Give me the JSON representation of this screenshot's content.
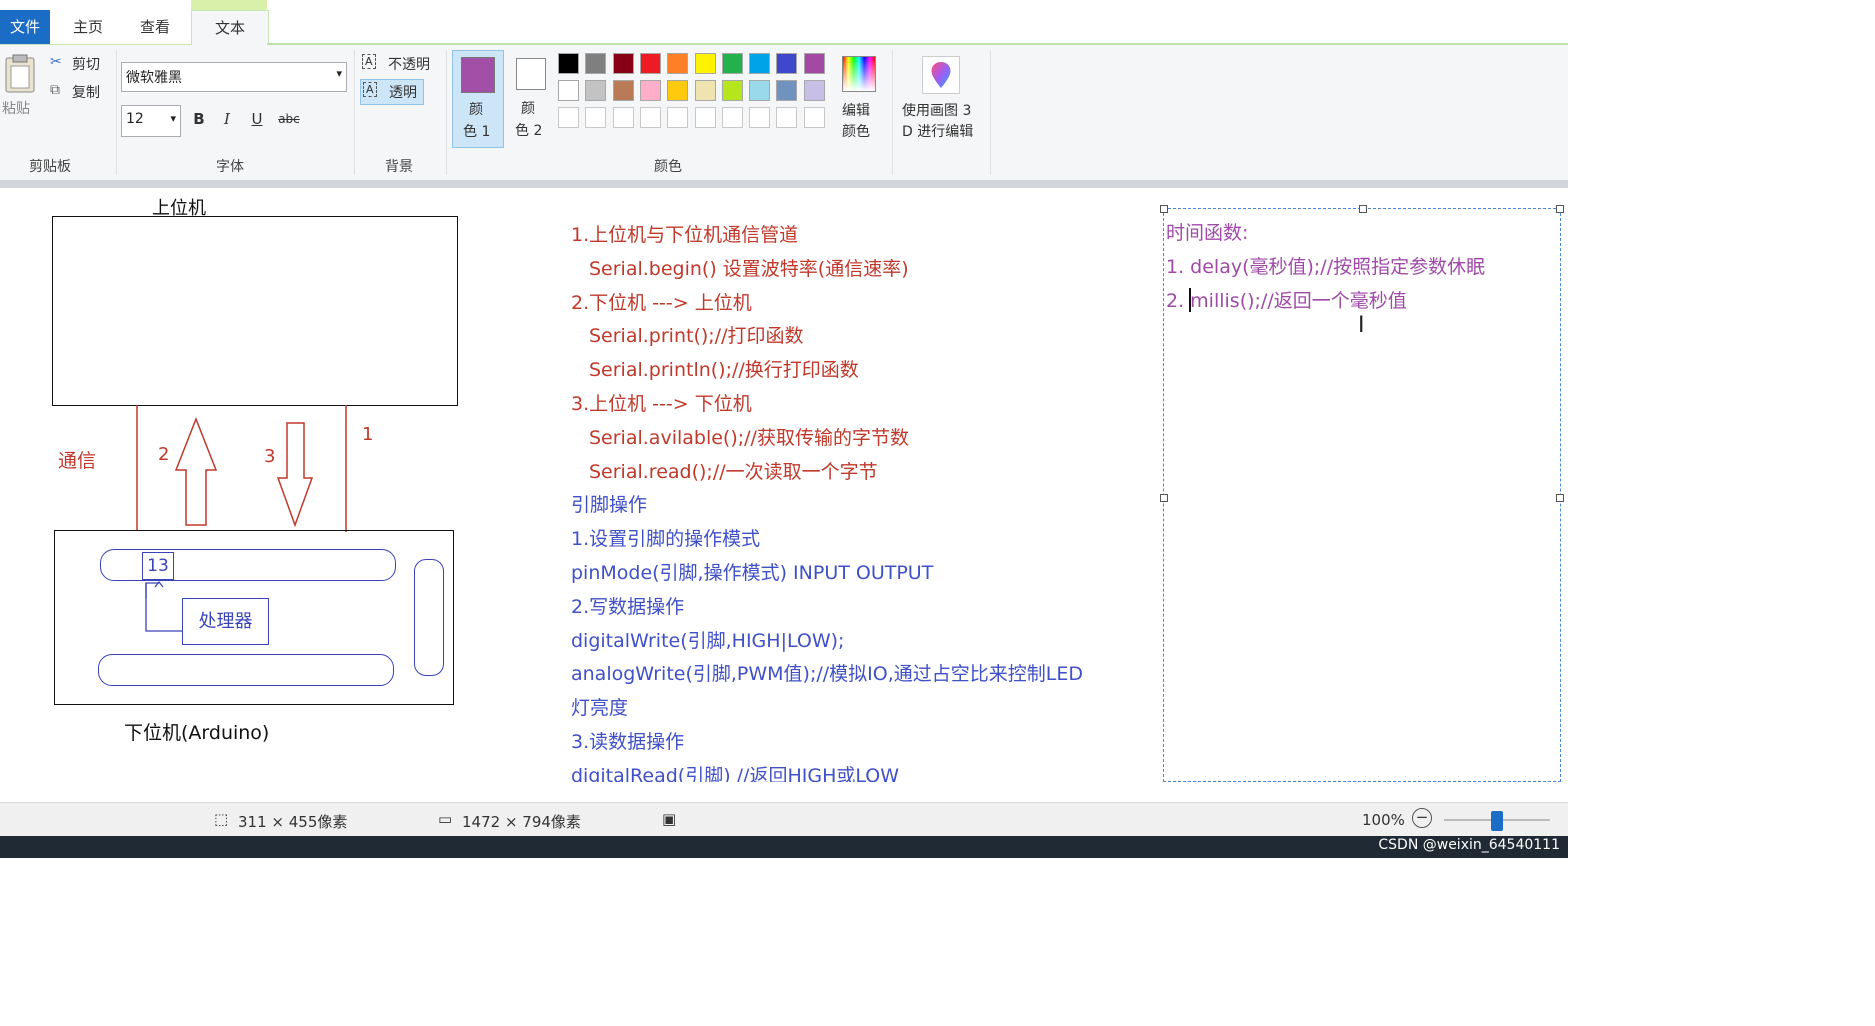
{
  "tabs": {
    "file": "文件",
    "home": "主页",
    "view": "查看",
    "text": "文本"
  },
  "ribbon": {
    "clipboard": {
      "paste": "粘贴",
      "cut": "剪切",
      "copy": "复制",
      "group_label": "剪贴板"
    },
    "font": {
      "family": "微软雅黑",
      "size": "12",
      "bold": "B",
      "italic": "I",
      "underline": "U",
      "strike": "abc",
      "group_label": "字体"
    },
    "background": {
      "opaque": "不透明",
      "transparent": "透明",
      "group_label": "背景"
    },
    "colors": {
      "color1_line1": "颜",
      "color1_line2": "色 1",
      "color2_line1": "颜",
      "color2_line2": "色 2",
      "edit_line1": "编辑",
      "edit_line2": "颜色",
      "group_label": "颜色",
      "color1": "#a24fa8",
      "color2": "#ffffff",
      "palette_row1": [
        "#000000",
        "#7f7f7f",
        "#880015",
        "#ed1c24",
        "#ff7f27",
        "#fff200",
        "#22b14c",
        "#00a2e8",
        "#3f48cc",
        "#a349a4"
      ],
      "palette_row2": [
        "#ffffff",
        "#c3c3c3",
        "#b97a57",
        "#ffaec9",
        "#ffc90e",
        "#efe4b0",
        "#b5e61d",
        "#99d9ea",
        "#7092be",
        "#c8bfe7"
      ]
    },
    "paint3d": {
      "line1": "使用画图 3",
      "line2": "D 进行编辑"
    }
  },
  "canvas": {
    "diagram": {
      "upper_label": "上位机",
      "lower_label": "下位机(Arduino)",
      "comm_label": "通信",
      "arrow_up_num": "2",
      "arrow_down_num": "3",
      "line_num": "1",
      "pin_num": "13",
      "processor": "处理器"
    },
    "notes": [
      {
        "text": "1.上位机与下位机通信管道",
        "color": "red",
        "indent": false
      },
      {
        "text": "Serial.begin() 设置波特率(通信速率)",
        "color": "red",
        "indent": true
      },
      {
        "text": "2.下位机 ---> 上位机",
        "color": "red",
        "indent": false
      },
      {
        "text": "Serial.print();//打印函数",
        "color": "red",
        "indent": true
      },
      {
        "text": "Serial.println();//换行打印函数",
        "color": "red",
        "indent": true
      },
      {
        "text": "3.上位机 ---> 下位机",
        "color": "red",
        "indent": false
      },
      {
        "text": "Serial.avilable();//获取传输的字节数",
        "color": "red",
        "indent": true
      },
      {
        "text": "Serial.read();//一次读取一个字节",
        "color": "red",
        "indent": true
      },
      {
        "text": "引脚操作",
        "color": "blue",
        "indent": false
      },
      {
        "text": "1.设置引脚的操作模式",
        "color": "blue",
        "indent": false
      },
      {
        "text": "pinMode(引脚,操作模式) INPUT OUTPUT",
        "color": "blue",
        "indent": false
      },
      {
        "text": "2.写数据操作",
        "color": "blue",
        "indent": false
      },
      {
        "text": "digitalWrite(引脚,HIGH|LOW);",
        "color": "blue",
        "indent": false
      },
      {
        "text": "analogWrite(引脚,PWM值);//模拟IO,通过占空比来控制LED",
        "color": "blue",
        "indent": false
      },
      {
        "text": "灯亮度",
        "color": "blue",
        "indent": false
      },
      {
        "text": "3.读数据操作",
        "color": "blue",
        "indent": false
      },
      {
        "text": "digitalRead(引脚) //返回HIGH或LOW",
        "color": "blue",
        "indent": false
      }
    ],
    "textbox": {
      "title": "时间函数:",
      "line1": "1. delay(毫秒值);//按照指定参数休眠",
      "line2": "2. millis();//返回一个毫秒值"
    }
  },
  "status": {
    "selection_size": "311 × 455像素",
    "image_size": "1472 × 794像素",
    "zoom": "100%",
    "zoom_level_percent": 100,
    "watermark": "CSDN @weixin_64540111"
  }
}
